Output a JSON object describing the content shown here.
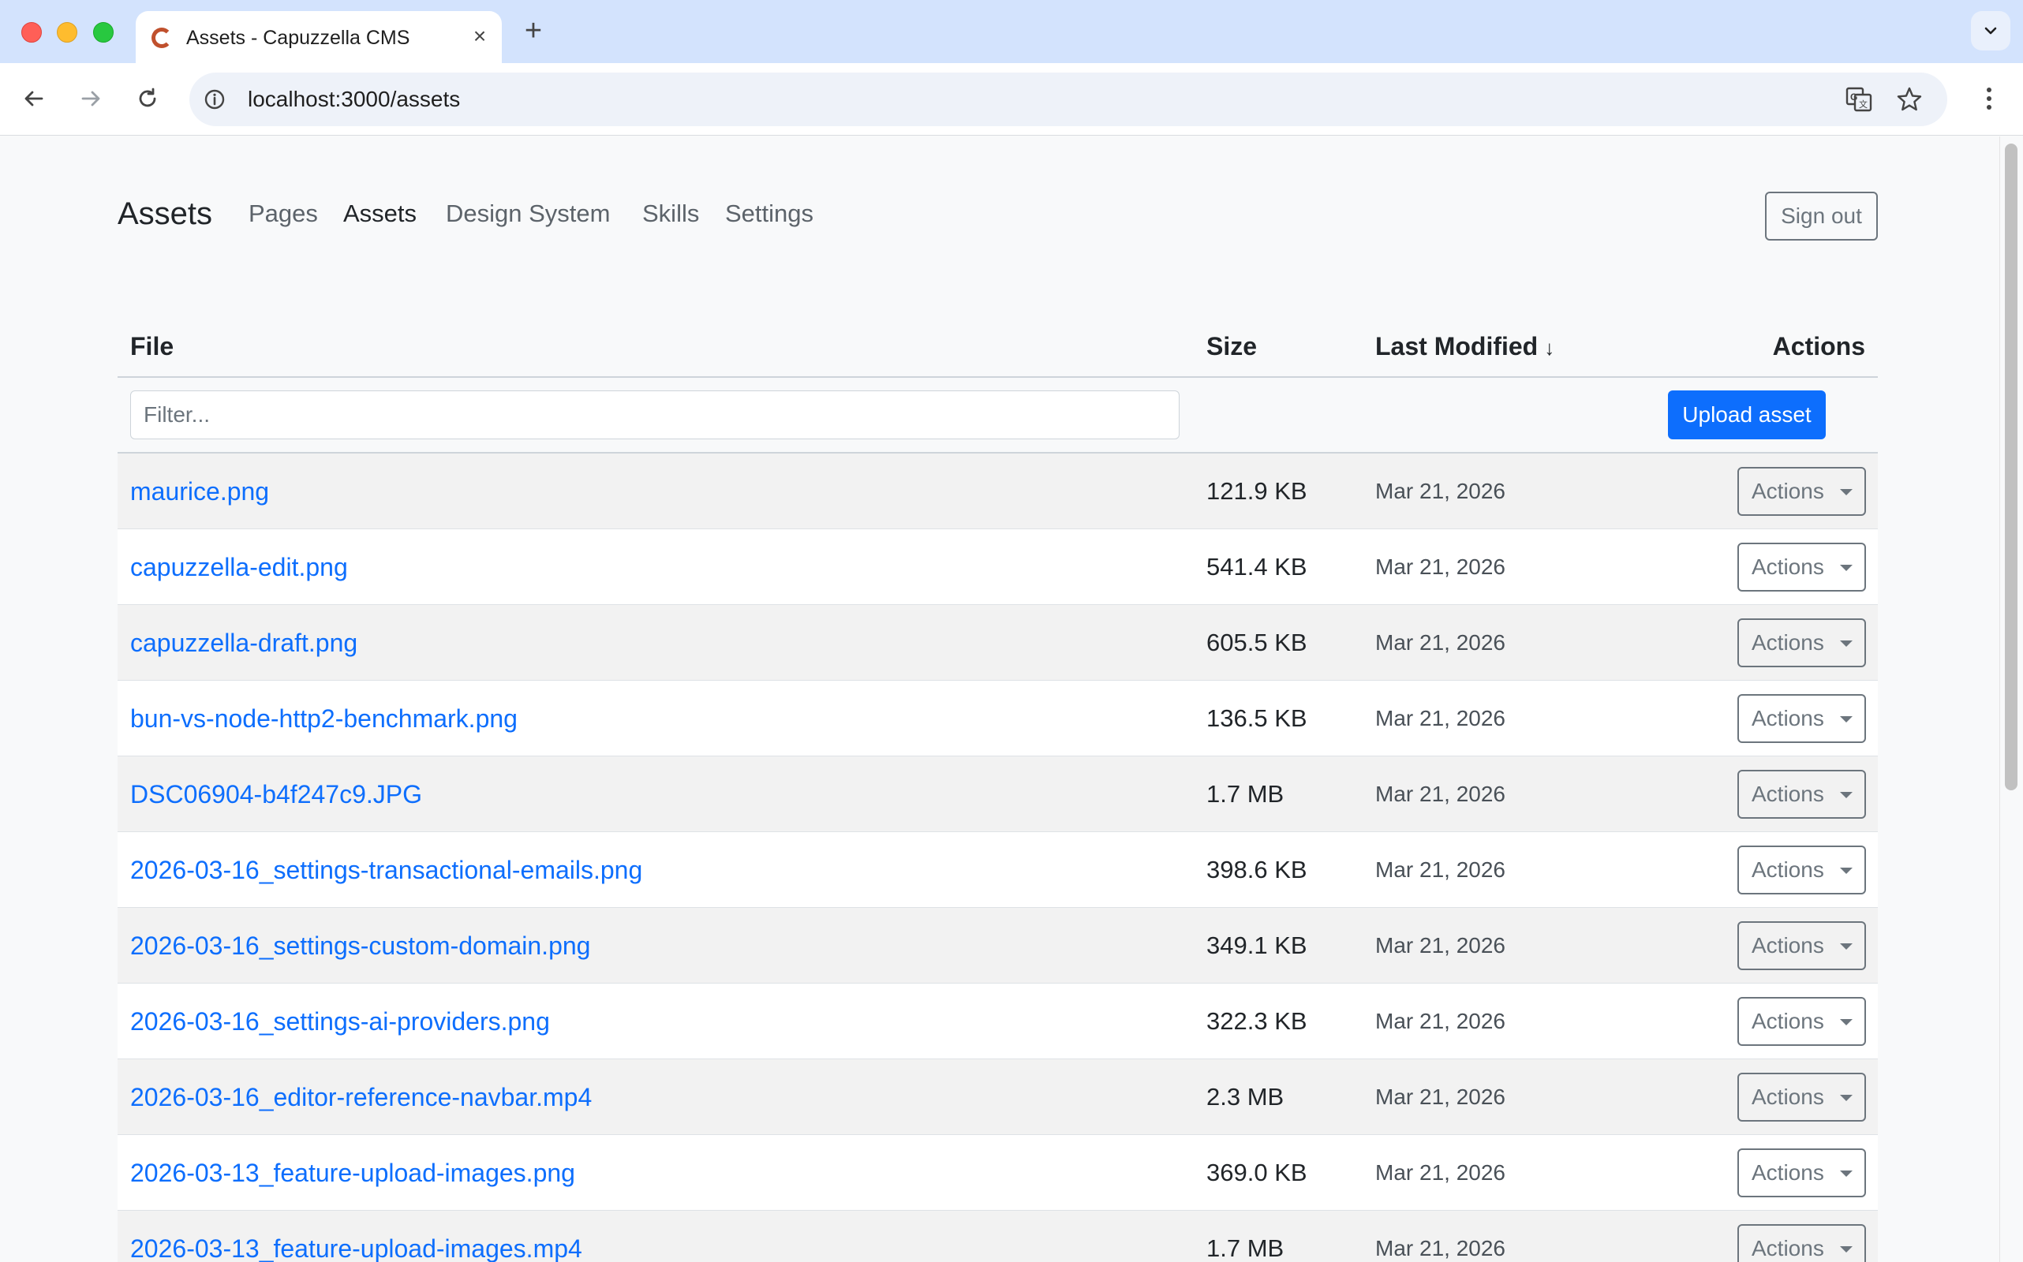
{
  "browser": {
    "tab_title": "Assets - Capuzzella CMS",
    "url": "localhost:3000/assets"
  },
  "nav": {
    "brand": "Assets",
    "links": [
      {
        "label": "Pages"
      },
      {
        "label": "Assets"
      },
      {
        "label": "Design System"
      },
      {
        "label": "Skills"
      },
      {
        "label": "Settings"
      }
    ],
    "active": "Assets",
    "sign_out": "Sign out"
  },
  "table": {
    "headers": {
      "file": "File",
      "size": "Size",
      "modified": "Last Modified",
      "sort_indicator": "↓",
      "actions": "Actions"
    },
    "filter_placeholder": "Filter...",
    "upload_label": "Upload asset",
    "action_label": "Actions",
    "rows": [
      {
        "file": "maurice.png",
        "size": "121.9 KB",
        "modified": "Mar 21, 2026"
      },
      {
        "file": "capuzzella-edit.png",
        "size": "541.4 KB",
        "modified": "Mar 21, 2026"
      },
      {
        "file": "capuzzella-draft.png",
        "size": "605.5 KB",
        "modified": "Mar 21, 2026"
      },
      {
        "file": "bun-vs-node-http2-benchmark.png",
        "size": "136.5 KB",
        "modified": "Mar 21, 2026"
      },
      {
        "file": "DSC06904-b4f247c9.JPG",
        "size": "1.7 MB",
        "modified": "Mar 21, 2026"
      },
      {
        "file": "2026-03-16_settings-transactional-emails.png",
        "size": "398.6 KB",
        "modified": "Mar 21, 2026"
      },
      {
        "file": "2026-03-16_settings-custom-domain.png",
        "size": "349.1 KB",
        "modified": "Mar 21, 2026"
      },
      {
        "file": "2026-03-16_settings-ai-providers.png",
        "size": "322.3 KB",
        "modified": "Mar 21, 2026"
      },
      {
        "file": "2026-03-16_editor-reference-navbar.mp4",
        "size": "2.3 MB",
        "modified": "Mar 21, 2026"
      },
      {
        "file": "2026-03-13_feature-upload-images.png",
        "size": "369.0 KB",
        "modified": "Mar 21, 2026"
      },
      {
        "file": "2026-03-13_feature-upload-images.mp4",
        "size": "1.7 MB",
        "modified": "Mar 21, 2026"
      }
    ]
  },
  "colors": {
    "link": "#0d6efd",
    "primary_button": "#0d6efd",
    "tabstrip": "#d3e3fd"
  }
}
